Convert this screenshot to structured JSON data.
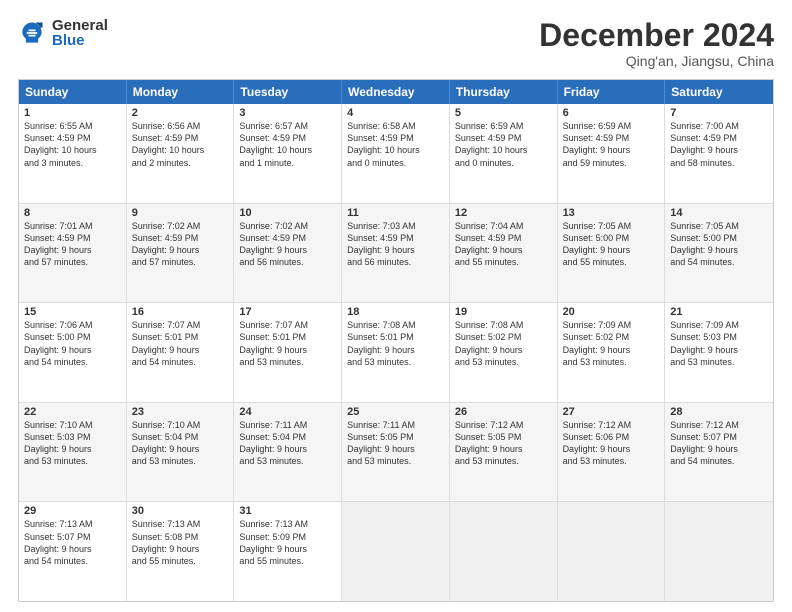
{
  "logo": {
    "general": "General",
    "blue": "Blue"
  },
  "title": "December 2024",
  "subtitle": "Qing'an, Jiangsu, China",
  "header_days": [
    "Sunday",
    "Monday",
    "Tuesday",
    "Wednesday",
    "Thursday",
    "Friday",
    "Saturday"
  ],
  "weeks": [
    [
      {
        "day": "1",
        "lines": [
          "Sunrise: 6:55 AM",
          "Sunset: 4:59 PM",
          "Daylight: 10 hours",
          "and 3 minutes."
        ]
      },
      {
        "day": "2",
        "lines": [
          "Sunrise: 6:56 AM",
          "Sunset: 4:59 PM",
          "Daylight: 10 hours",
          "and 2 minutes."
        ]
      },
      {
        "day": "3",
        "lines": [
          "Sunrise: 6:57 AM",
          "Sunset: 4:59 PM",
          "Daylight: 10 hours",
          "and 1 minute."
        ]
      },
      {
        "day": "4",
        "lines": [
          "Sunrise: 6:58 AM",
          "Sunset: 4:59 PM",
          "Daylight: 10 hours",
          "and 0 minutes."
        ]
      },
      {
        "day": "5",
        "lines": [
          "Sunrise: 6:59 AM",
          "Sunset: 4:59 PM",
          "Daylight: 10 hours",
          "and 0 minutes."
        ]
      },
      {
        "day": "6",
        "lines": [
          "Sunrise: 6:59 AM",
          "Sunset: 4:59 PM",
          "Daylight: 9 hours",
          "and 59 minutes."
        ]
      },
      {
        "day": "7",
        "lines": [
          "Sunrise: 7:00 AM",
          "Sunset: 4:59 PM",
          "Daylight: 9 hours",
          "and 58 minutes."
        ]
      }
    ],
    [
      {
        "day": "8",
        "lines": [
          "Sunrise: 7:01 AM",
          "Sunset: 4:59 PM",
          "Daylight: 9 hours",
          "and 57 minutes."
        ]
      },
      {
        "day": "9",
        "lines": [
          "Sunrise: 7:02 AM",
          "Sunset: 4:59 PM",
          "Daylight: 9 hours",
          "and 57 minutes."
        ]
      },
      {
        "day": "10",
        "lines": [
          "Sunrise: 7:02 AM",
          "Sunset: 4:59 PM",
          "Daylight: 9 hours",
          "and 56 minutes."
        ]
      },
      {
        "day": "11",
        "lines": [
          "Sunrise: 7:03 AM",
          "Sunset: 4:59 PM",
          "Daylight: 9 hours",
          "and 56 minutes."
        ]
      },
      {
        "day": "12",
        "lines": [
          "Sunrise: 7:04 AM",
          "Sunset: 4:59 PM",
          "Daylight: 9 hours",
          "and 55 minutes."
        ]
      },
      {
        "day": "13",
        "lines": [
          "Sunrise: 7:05 AM",
          "Sunset: 5:00 PM",
          "Daylight: 9 hours",
          "and 55 minutes."
        ]
      },
      {
        "day": "14",
        "lines": [
          "Sunrise: 7:05 AM",
          "Sunset: 5:00 PM",
          "Daylight: 9 hours",
          "and 54 minutes."
        ]
      }
    ],
    [
      {
        "day": "15",
        "lines": [
          "Sunrise: 7:06 AM",
          "Sunset: 5:00 PM",
          "Daylight: 9 hours",
          "and 54 minutes."
        ]
      },
      {
        "day": "16",
        "lines": [
          "Sunrise: 7:07 AM",
          "Sunset: 5:01 PM",
          "Daylight: 9 hours",
          "and 54 minutes."
        ]
      },
      {
        "day": "17",
        "lines": [
          "Sunrise: 7:07 AM",
          "Sunset: 5:01 PM",
          "Daylight: 9 hours",
          "and 53 minutes."
        ]
      },
      {
        "day": "18",
        "lines": [
          "Sunrise: 7:08 AM",
          "Sunset: 5:01 PM",
          "Daylight: 9 hours",
          "and 53 minutes."
        ]
      },
      {
        "day": "19",
        "lines": [
          "Sunrise: 7:08 AM",
          "Sunset: 5:02 PM",
          "Daylight: 9 hours",
          "and 53 minutes."
        ]
      },
      {
        "day": "20",
        "lines": [
          "Sunrise: 7:09 AM",
          "Sunset: 5:02 PM",
          "Daylight: 9 hours",
          "and 53 minutes."
        ]
      },
      {
        "day": "21",
        "lines": [
          "Sunrise: 7:09 AM",
          "Sunset: 5:03 PM",
          "Daylight: 9 hours",
          "and 53 minutes."
        ]
      }
    ],
    [
      {
        "day": "22",
        "lines": [
          "Sunrise: 7:10 AM",
          "Sunset: 5:03 PM",
          "Daylight: 9 hours",
          "and 53 minutes."
        ]
      },
      {
        "day": "23",
        "lines": [
          "Sunrise: 7:10 AM",
          "Sunset: 5:04 PM",
          "Daylight: 9 hours",
          "and 53 minutes."
        ]
      },
      {
        "day": "24",
        "lines": [
          "Sunrise: 7:11 AM",
          "Sunset: 5:04 PM",
          "Daylight: 9 hours",
          "and 53 minutes."
        ]
      },
      {
        "day": "25",
        "lines": [
          "Sunrise: 7:11 AM",
          "Sunset: 5:05 PM",
          "Daylight: 9 hours",
          "and 53 minutes."
        ]
      },
      {
        "day": "26",
        "lines": [
          "Sunrise: 7:12 AM",
          "Sunset: 5:05 PM",
          "Daylight: 9 hours",
          "and 53 minutes."
        ]
      },
      {
        "day": "27",
        "lines": [
          "Sunrise: 7:12 AM",
          "Sunset: 5:06 PM",
          "Daylight: 9 hours",
          "and 53 minutes."
        ]
      },
      {
        "day": "28",
        "lines": [
          "Sunrise: 7:12 AM",
          "Sunset: 5:07 PM",
          "Daylight: 9 hours",
          "and 54 minutes."
        ]
      }
    ],
    [
      {
        "day": "29",
        "lines": [
          "Sunrise: 7:13 AM",
          "Sunset: 5:07 PM",
          "Daylight: 9 hours",
          "and 54 minutes."
        ]
      },
      {
        "day": "30",
        "lines": [
          "Sunrise: 7:13 AM",
          "Sunset: 5:08 PM",
          "Daylight: 9 hours",
          "and 55 minutes."
        ]
      },
      {
        "day": "31",
        "lines": [
          "Sunrise: 7:13 AM",
          "Sunset: 5:09 PM",
          "Daylight: 9 hours",
          "and 55 minutes."
        ]
      },
      {
        "day": "",
        "lines": []
      },
      {
        "day": "",
        "lines": []
      },
      {
        "day": "",
        "lines": []
      },
      {
        "day": "",
        "lines": []
      }
    ]
  ]
}
